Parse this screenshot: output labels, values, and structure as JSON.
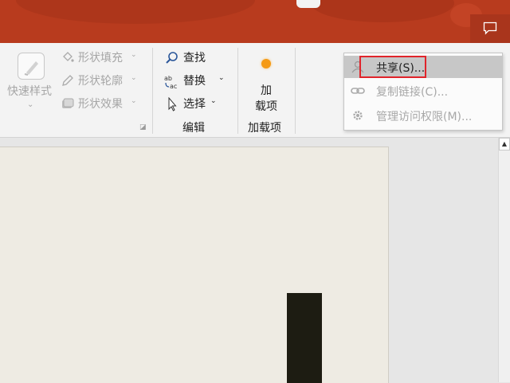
{
  "title": "",
  "comment_icon": "comment-icon",
  "ribbon": {
    "quick_style": {
      "label": "快速样式",
      "icon": "quick-style-icon"
    },
    "shape_items": [
      {
        "label": "形状填充",
        "icon": "paint-bucket-icon"
      },
      {
        "label": "形状轮廓",
        "icon": "pencil-icon"
      },
      {
        "label": "形状效果",
        "icon": "shape-effects-icon"
      }
    ],
    "editing": {
      "find": {
        "label": "查找",
        "icon": "search-icon"
      },
      "replace": {
        "label": "替换",
        "icon": "replace-icon"
      },
      "select": {
        "label": "选择",
        "icon": "cursor-icon"
      },
      "group_label": "编辑"
    },
    "addins": {
      "button_label_line1": "加",
      "button_label_line2": "载项",
      "group_label": "加载项",
      "icon": "addin-icon"
    }
  },
  "share_menu": {
    "items": [
      {
        "label": "共享(S)...",
        "icon": "person-icon",
        "selected": true,
        "enabled": true
      },
      {
        "label": "复制链接(C)...",
        "icon": "link-icon",
        "selected": false,
        "enabled": false
      },
      {
        "label": "管理访问权限(M)...",
        "icon": "gear-icon",
        "selected": false,
        "enabled": false
      }
    ]
  },
  "colors": {
    "titlebar": "#b83b1e",
    "highlight_border": "#e0242b",
    "addin": "#f59a14"
  }
}
